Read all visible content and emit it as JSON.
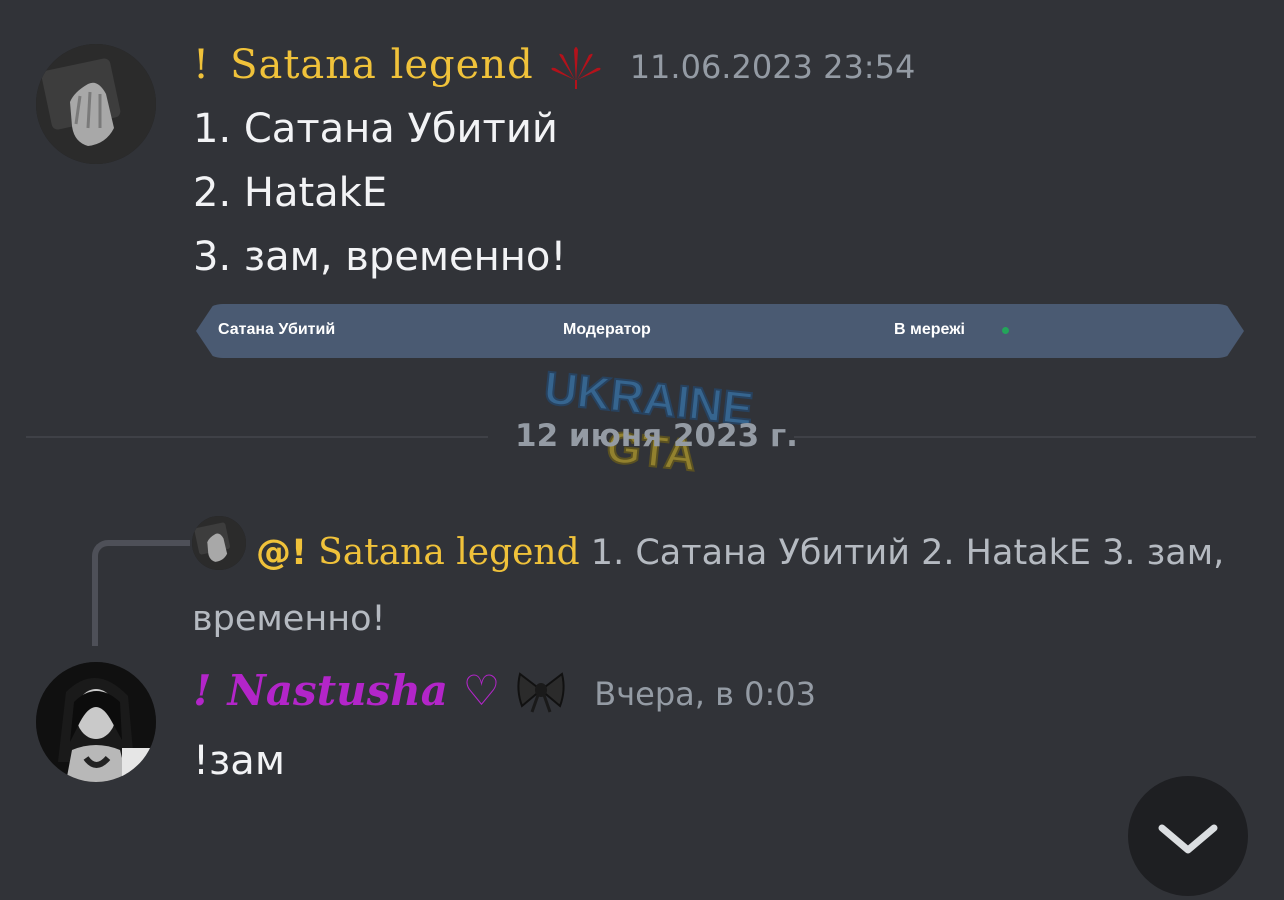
{
  "colors": {
    "background": "#313338",
    "gold_username": "#f0c23a",
    "purple_username": "#b325c9",
    "muted_text": "#949ba4",
    "embed_bg": "#4a5a72",
    "online_dot": "#23a55a"
  },
  "message1": {
    "prefix": "!",
    "username": "Satana legend",
    "badge_icon": "cannabis-leaf-icon",
    "timestamp": "11.06.2023 23:54",
    "lines": [
      "1. Сатана Убитий",
      "2. HatakE",
      "3. зам, временно!"
    ],
    "embed": {
      "name": "Сатана Убитий",
      "role": "Модератор",
      "status": "В мережі"
    }
  },
  "divider": {
    "date": "12 июня 2023 г."
  },
  "watermark": {
    "line1": "UKRAINE",
    "line2": "GTA"
  },
  "reply": {
    "mention": "@!",
    "username": "Satana legend",
    "text": "1. Сатана Убитий 2. HatakE 3. зам, временно!"
  },
  "message2": {
    "prefix": "!",
    "username": "Nastusha ♡",
    "badge_icon": "bow-icon",
    "timestamp": "Вчера, в 0:03",
    "text": "!зам"
  },
  "scroll_button": {
    "icon": "chevron-down-icon"
  }
}
